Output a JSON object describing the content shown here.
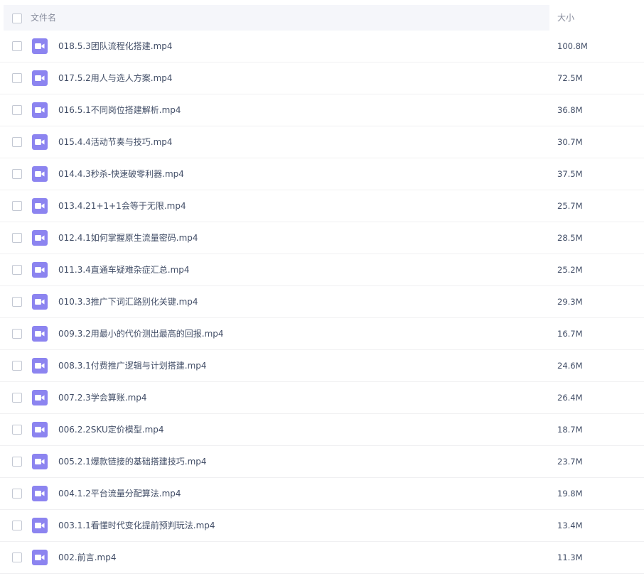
{
  "header": {
    "name_label": "文件名",
    "size_label": "大小"
  },
  "files": [
    {
      "name": "018.5.3团队流程化搭建.mp4",
      "size": "100.8M",
      "icon": "video-file-icon"
    },
    {
      "name": "017.5.2用人与选人方案.mp4",
      "size": "72.5M",
      "icon": "video-file-icon"
    },
    {
      "name": "016.5.1不同岗位搭建解析.mp4",
      "size": "36.8M",
      "icon": "video-file-icon"
    },
    {
      "name": "015.4.4活动节奏与技巧.mp4",
      "size": "30.7M",
      "icon": "video-file-icon"
    },
    {
      "name": "014.4.3秒杀-快速破零利器.mp4",
      "size": "37.5M",
      "icon": "video-file-icon"
    },
    {
      "name": "013.4.21+1+1会等于无限.mp4",
      "size": "25.7M",
      "icon": "video-file-icon"
    },
    {
      "name": "012.4.1如何掌握原生流量密码.mp4",
      "size": "28.5M",
      "icon": "video-file-icon"
    },
    {
      "name": "011.3.4直通车疑难杂症汇总.mp4",
      "size": "25.2M",
      "icon": "video-file-icon"
    },
    {
      "name": "010.3.3推广下词汇路别化关键.mp4",
      "size": "29.3M",
      "icon": "video-file-icon"
    },
    {
      "name": "009.3.2用最小的代价测出最高的回报.mp4",
      "size": "16.7M",
      "icon": "video-file-icon"
    },
    {
      "name": "008.3.1付费推广逻辑与计划搭建.mp4",
      "size": "24.6M",
      "icon": "video-file-icon"
    },
    {
      "name": "007.2.3学会算账.mp4",
      "size": "26.4M",
      "icon": "video-file-icon"
    },
    {
      "name": "006.2.2SKU定价模型.mp4",
      "size": "18.7M",
      "icon": "video-file-icon"
    },
    {
      "name": "005.2.1爆款链接的基础搭建技巧.mp4",
      "size": "23.7M",
      "icon": "video-file-icon"
    },
    {
      "name": "004.1.2平台流量分配算法.mp4",
      "size": "19.8M",
      "icon": "video-file-icon"
    },
    {
      "name": "003.1.1看懂时代变化提前预判玩法.mp4",
      "size": "13.4M",
      "icon": "video-file-icon"
    },
    {
      "name": "002.前言.mp4",
      "size": "11.3M",
      "icon": "video-file-icon"
    }
  ],
  "colors": {
    "icon_bg": "#8c84f0",
    "header_bg": "#f5f6fa",
    "text": "#424e67",
    "header_text": "#878c9c"
  }
}
